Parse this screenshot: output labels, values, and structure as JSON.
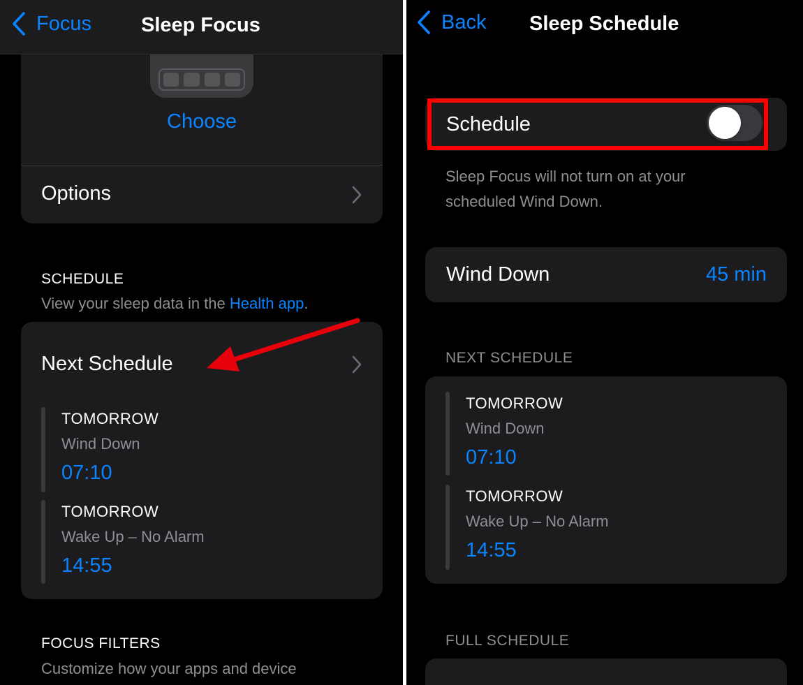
{
  "left": {
    "nav": {
      "back_label": "Focus",
      "title": "Sleep Focus"
    },
    "top_card": {
      "choose_label": "Choose",
      "options_label": "Options"
    },
    "schedule_section": {
      "header": "SCHEDULE",
      "sub_prefix": "View your sleep data in the ",
      "sub_link": "Health app",
      "sub_suffix": "."
    },
    "next_schedule": {
      "title": "Next Schedule",
      "entries": [
        {
          "day": "TOMORROW",
          "kind": "Wind Down",
          "time": "07:10"
        },
        {
          "day": "TOMORROW",
          "kind": "Wake Up – No Alarm",
          "time": "14:55"
        }
      ]
    },
    "focus_filters": {
      "header": "FOCUS FILTERS",
      "sub": "Customize how your apps and device"
    }
  },
  "right": {
    "nav": {
      "back_label": "Back",
      "title": "Sleep Schedule"
    },
    "schedule_toggle": {
      "label": "Schedule",
      "state": "off"
    },
    "schedule_note": [
      "Sleep Focus will not turn on at your",
      "scheduled Wind Down."
    ],
    "wind_down": {
      "label": "Wind Down",
      "value": "45 min"
    },
    "next_schedule": {
      "header": "NEXT SCHEDULE",
      "entries": [
        {
          "day": "TOMORROW",
          "kind": "Wind Down",
          "time": "07:10"
        },
        {
          "day": "TOMORROW",
          "kind": "Wake Up – No Alarm",
          "time": "14:55"
        }
      ]
    },
    "full_schedule": {
      "header": "FULL SCHEDULE"
    }
  },
  "colors": {
    "accent": "#0a84ff",
    "background": "#000000",
    "card": "#1c1c1e",
    "secondary_text": "#8e8e93",
    "annotation": "#ff0000"
  }
}
